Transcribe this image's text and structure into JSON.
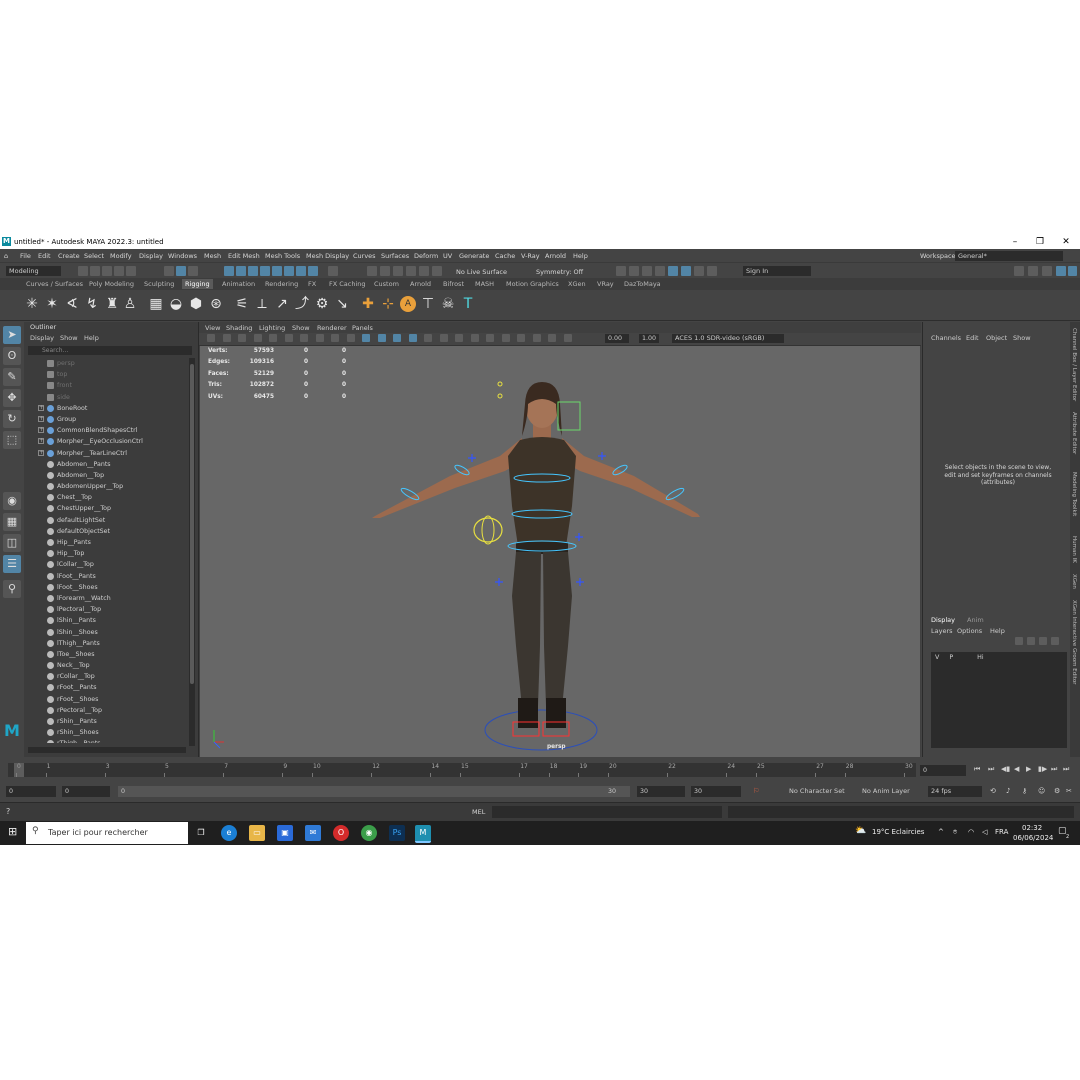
{
  "window": {
    "title": "untitled* - Autodesk MAYA 2022.3: untitled",
    "logo_letter": "M",
    "minimize": "–",
    "restore": "❐",
    "close": "✕"
  },
  "menu": [
    "File",
    "Edit",
    "Create",
    "Select",
    "Modify",
    "Display",
    "Windows",
    "Mesh",
    "Edit Mesh",
    "Mesh Tools",
    "Mesh Display",
    "Curves",
    "Surfaces",
    "Deform",
    "UV",
    "Generate",
    "Cache",
    "V-Ray",
    "Arnold",
    "Help"
  ],
  "workspace": {
    "label": "Workspace:",
    "value": "General*"
  },
  "status_line": {
    "mode": "Modeling",
    "live_surface": "No Live Surface",
    "symmetry": "Symmetry: Off",
    "sign_in": "Sign In"
  },
  "shelf_tabs": [
    "Curves / Surfaces",
    "Poly Modeling",
    "Sculpting",
    "Rigging",
    "Animation",
    "Rendering",
    "FX",
    "FX Caching",
    "Custom",
    "Arnold",
    "Bifrost",
    "MASH",
    "Motion Graphics",
    "XGen",
    "VRay",
    "DazToMaya"
  ],
  "active_shelf_tab": "Rigging",
  "outliner": {
    "title": "Outliner",
    "menus": [
      "Display",
      "Show",
      "Help"
    ],
    "search_placeholder": "Search...",
    "cameras": [
      "persp",
      "top",
      "front",
      "side"
    ],
    "groups": [
      "BoneRoot",
      "Group",
      "CommonBlendShapesCtrl",
      "Morpher__EyeOcclusionCtrl",
      "Morpher__TearLineCtrl"
    ],
    "items": [
      "Abdomen__Pants",
      "Abdomen__Top",
      "AbdomenUpper__Top",
      "Chest__Top",
      "ChestUpper__Top",
      "defaultLightSet",
      "defaultObjectSet",
      "Hip__Pants",
      "Hip__Top",
      "lCollar__Top",
      "lFoot__Pants",
      "lFoot__Shoes",
      "lForearm__Watch",
      "lPectoral__Top",
      "lShin__Pants",
      "lShin__Shoes",
      "lThigh__Pants",
      "lToe__Shoes",
      "Neck__Top",
      "rCollar__Top",
      "rFoot__Pants",
      "rFoot__Shoes",
      "rPectoral__Top",
      "rShin__Pants",
      "rShin__Shoes",
      "rThigh__Pants"
    ]
  },
  "viewport": {
    "menus": [
      "View",
      "Shading",
      "Lighting",
      "Show",
      "Renderer",
      "Panels"
    ],
    "exposure": "0.00",
    "gamma": "1.00",
    "color_space": "ACES 1.0 SDR-video (sRGB)",
    "camera_label": "persp",
    "hud": [
      {
        "label": "Verts:",
        "value": "57593",
        "sel": "0",
        "obj": "0"
      },
      {
        "label": "Edges:",
        "value": "109316",
        "sel": "0",
        "obj": "0"
      },
      {
        "label": "Faces:",
        "value": "52129",
        "sel": "0",
        "obj": "0"
      },
      {
        "label": "Tris:",
        "value": "102872",
        "sel": "0",
        "obj": "0"
      },
      {
        "label": "UVs:",
        "value": "60475",
        "sel": "0",
        "obj": "0"
      }
    ]
  },
  "channel_box": {
    "menus": [
      "Channels",
      "Edit",
      "Object",
      "Show"
    ],
    "hint": "Select objects in the scene to view, edit and set keyframes on channels (attributes)",
    "layer_tabs": [
      "Display",
      "Anim"
    ],
    "layer_menus": [
      "Layers",
      "Options",
      "Help"
    ],
    "layer": {
      "v": "V",
      "p": "P",
      "name": "Hi"
    }
  },
  "side_tabs": [
    "Channel Box / Layer Editor",
    "Attribute Editor",
    "Modeling Toolkit",
    "Human IK",
    "XGen",
    "XGen Interactive Groom Editor"
  ],
  "timeline": {
    "ticks": [
      "0",
      "1",
      "3",
      "5",
      "7",
      "9",
      "10",
      "12",
      "14",
      "15",
      "17",
      "18",
      "19",
      "20",
      "22",
      "24",
      "25",
      "27",
      "28",
      "30"
    ],
    "tick_values": [
      0,
      1,
      3,
      5,
      7,
      9,
      10,
      12,
      14,
      15,
      17,
      18,
      19,
      20,
      22,
      24,
      25,
      27,
      28,
      30
    ],
    "max": 30,
    "current_frame": "0"
  },
  "range": {
    "start": "0",
    "start_inner": "0",
    "slider_start": "0",
    "slider_end": "30",
    "end_inner": "30",
    "end": "30",
    "character_set": "No Character Set",
    "anim_layer": "No Anim Layer",
    "fps": "24 fps"
  },
  "command_line": {
    "lang": "MEL"
  },
  "taskbar": {
    "search_placeholder": "Taper ici pour rechercher",
    "weather": "19°C  Eclaircies",
    "lang": "FRA",
    "time": "02:32",
    "date": "06/06/2024",
    "notifications": "2"
  },
  "colors": {
    "accent": "#5285a6",
    "panel": "#444444",
    "viewport": "#676767",
    "taskbar": "#1f1f1f"
  }
}
